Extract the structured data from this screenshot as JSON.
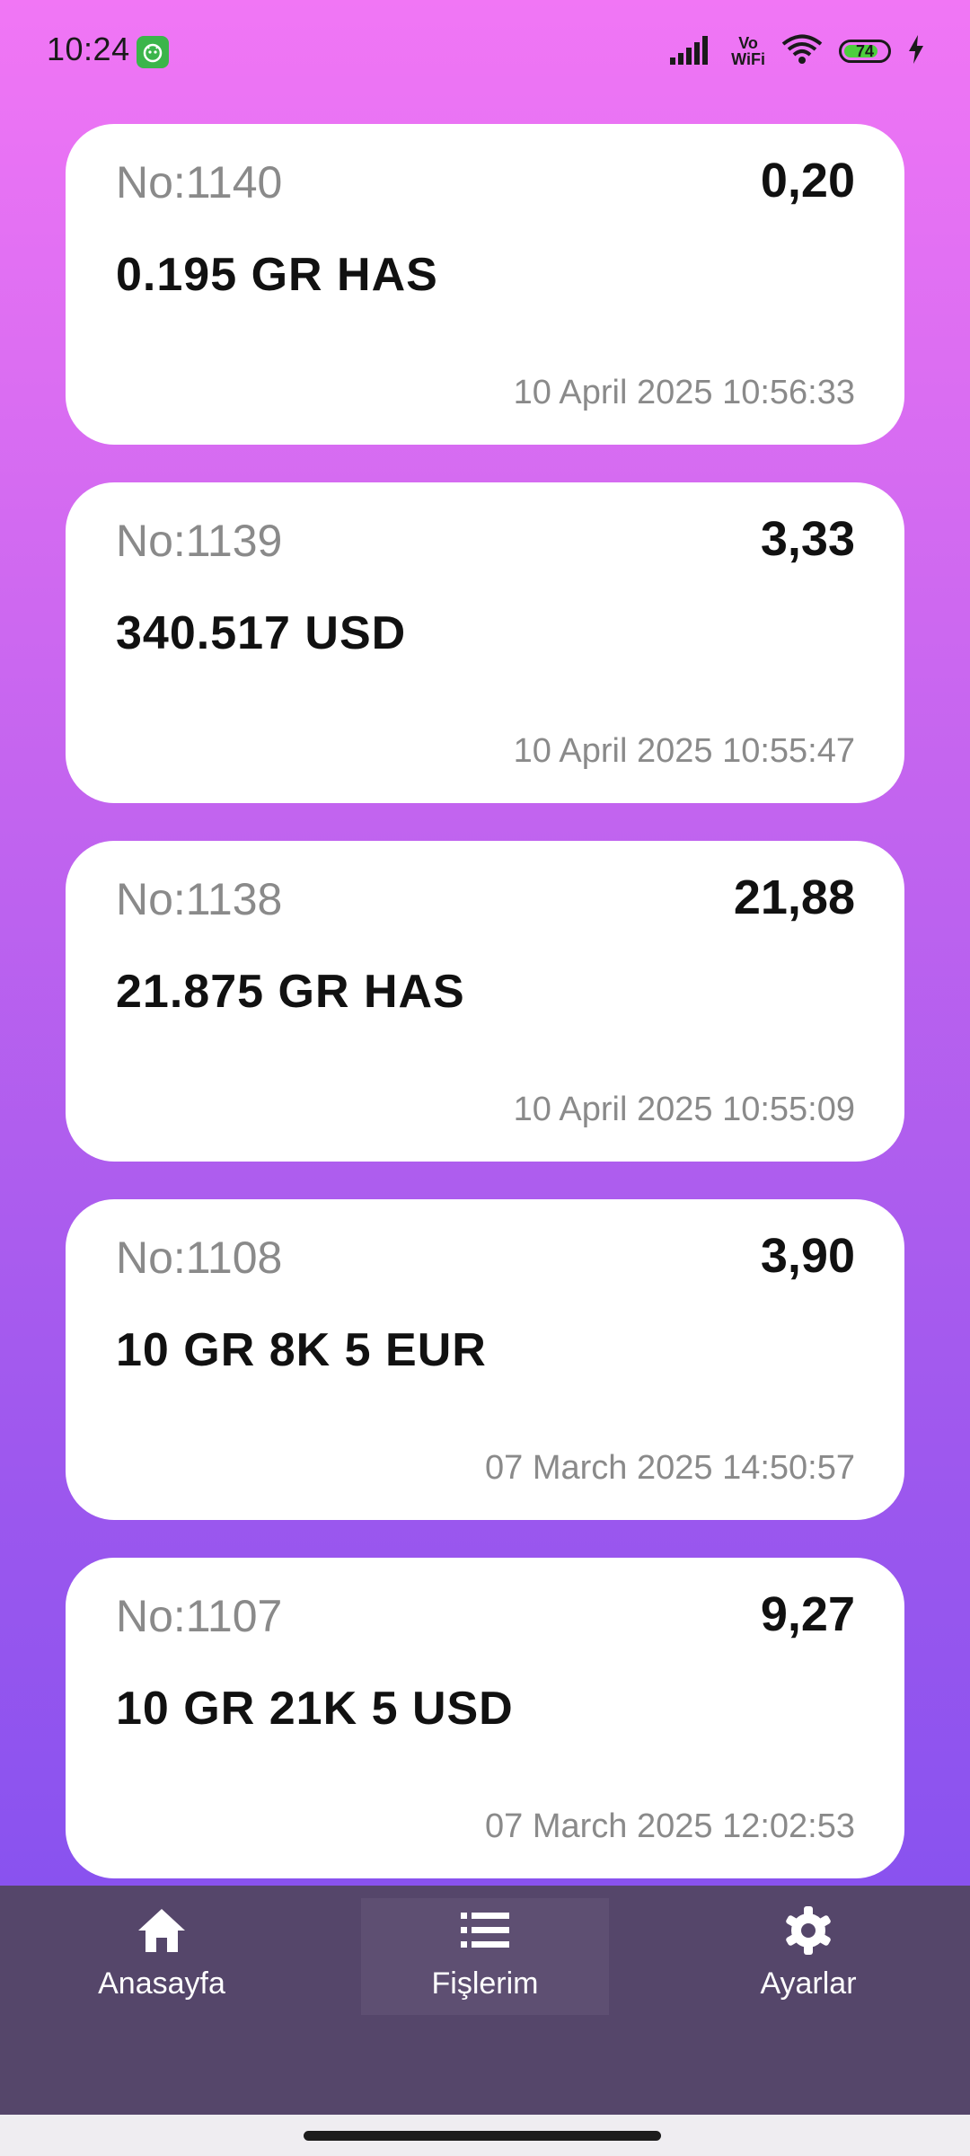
{
  "status_bar": {
    "time": "10:24",
    "vowifi_top": "Vo",
    "vowifi_bottom": "WiFi",
    "battery": "74"
  },
  "receipts": [
    {
      "no": "No:1140",
      "amount": "0,20",
      "description": "0.195 GR HAS",
      "date": "10 April 2025 10:56:33"
    },
    {
      "no": "No:1139",
      "amount": "3,33",
      "description": "340.517 USD",
      "date": "10 April 2025 10:55:47"
    },
    {
      "no": "No:1138",
      "amount": "21,88",
      "description": "21.875 GR HAS",
      "date": "10 April 2025 10:55:09"
    },
    {
      "no": "No:1108",
      "amount": "3,90",
      "description": "10 GR 8K 5 EUR",
      "date": "07 March 2025 14:50:57"
    },
    {
      "no": "No:1107",
      "amount": "9,27",
      "description": "10 GR 21K 5 USD",
      "date": "07 March 2025 12:02:53"
    }
  ],
  "nav": {
    "home_label": "Anasayfa",
    "receipts_label": "Fişlerim",
    "settings_label": "Ayarlar",
    "active": "receipts"
  },
  "colors": {
    "gradient_top": "#f176f5",
    "gradient_bottom": "#7c4ff0",
    "nav_background": "#55466a"
  }
}
